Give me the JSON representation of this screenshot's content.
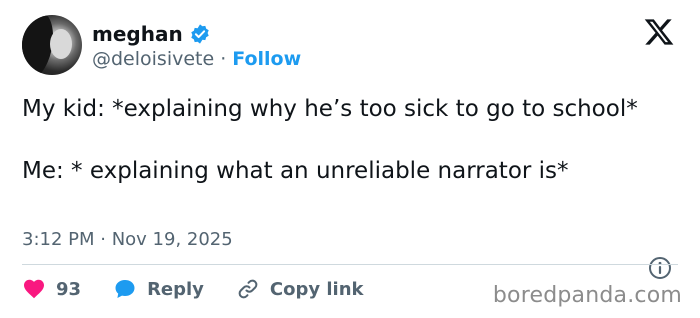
{
  "author": {
    "name": "meghan",
    "handle": "@deloisivete",
    "follow_label": "Follow",
    "separator": "·"
  },
  "post": {
    "line1": "My kid: *explaining why he’s too sick to go to school*",
    "line2": "Me: * explaining what an unreliable narrator is*",
    "timestamp": "3:12 PM · Nov 19, 2025"
  },
  "actions": {
    "likes": "93",
    "reply_label": "Reply",
    "copy_label": "Copy link"
  },
  "watermark": "boredpanda.com",
  "colors": {
    "accent": "#1d9bf0",
    "like": "#f91880",
    "text": "#0f1419",
    "muted": "#536471"
  },
  "icons": [
    "verified-badge-icon",
    "x-logo-icon",
    "info-icon",
    "heart-icon",
    "reply-bubble-icon",
    "link-icon"
  ]
}
